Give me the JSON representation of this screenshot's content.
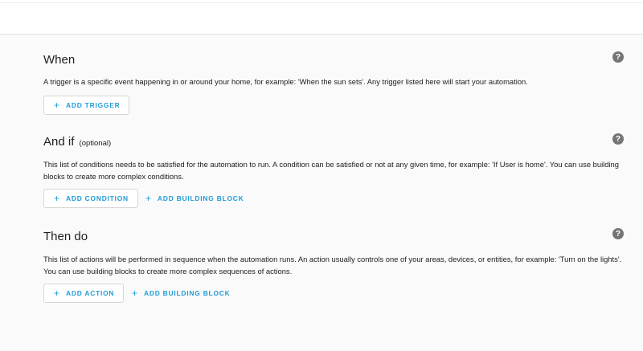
{
  "sections": {
    "when": {
      "title": "When",
      "description": "A trigger is a specific event happening in or around your home, for example: 'When the sun sets'. Any trigger listed here will start your automation.",
      "add_trigger_label": "ADD TRIGGER",
      "help_icon": "?"
    },
    "and_if": {
      "title": "And if",
      "optional": "(optional)",
      "description": "This list of conditions needs to be satisfied for the automation to run. A condition can be satisfied or not at any given time, for example: 'If User is home'. You can use building blocks to create more complex conditions.",
      "add_condition_label": "ADD CONDITION",
      "add_building_block_label": "ADD BUILDING BLOCK",
      "help_icon": "?"
    },
    "then_do": {
      "title": "Then do",
      "description": "This list of actions will be performed in sequence when the automation runs. An action usually controls one of your areas, devices, or entities, for example: 'Turn on the lights'. You can use building blocks to create more complex sequences of actions.",
      "add_action_label": "ADD ACTION",
      "add_building_block_label": "ADD BUILDING BLOCK",
      "help_icon": "?"
    }
  },
  "icons": {
    "plus": "+"
  },
  "colors": {
    "accent": "#1f9bd6",
    "background": "#fafafa",
    "help_icon": "#757575"
  }
}
